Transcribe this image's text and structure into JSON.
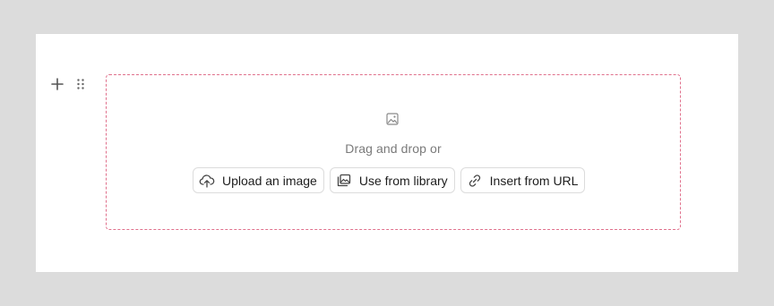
{
  "block_controls": {
    "add_icon": "plus-icon",
    "drag_icon": "drag-handle-icon"
  },
  "dropzone": {
    "icon": "image-icon",
    "prompt": "Drag and drop or",
    "border_color": "#e0708c"
  },
  "buttons": [
    {
      "label": "Upload an image",
      "icon": "upload-cloud-icon"
    },
    {
      "label": "Use from library",
      "icon": "library-images-icon"
    },
    {
      "label": "Insert from URL",
      "icon": "link-icon"
    }
  ]
}
